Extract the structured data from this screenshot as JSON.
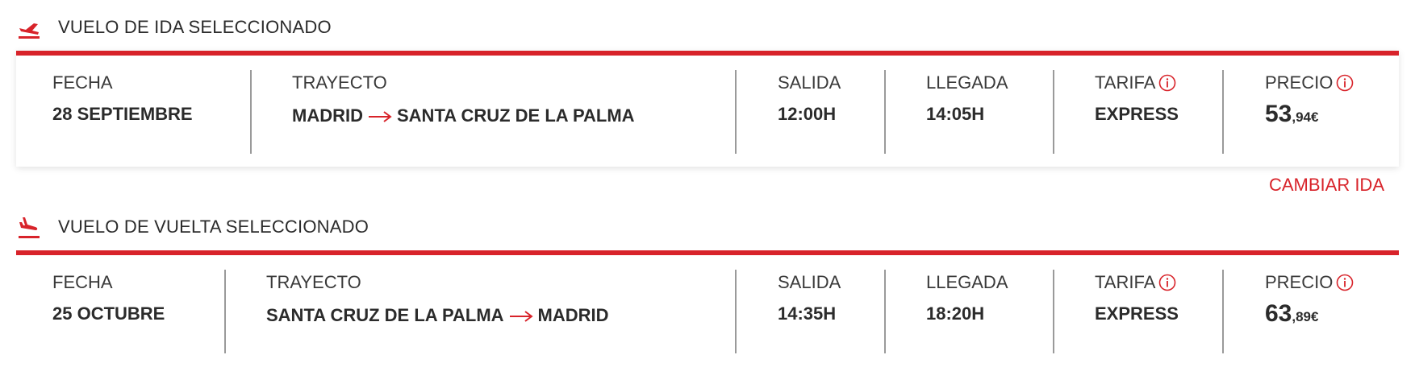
{
  "outbound": {
    "title": "VUELO DE IDA SELECCIONADO",
    "fecha_label": "FECHA",
    "fecha": "28 SEPTIEMBRE",
    "trayecto_label": "TRAYECTO",
    "origin": "MADRID",
    "destination": "SANTA CRUZ DE LA PALMA",
    "salida_label": "SALIDA",
    "salida": "12:00H",
    "llegada_label": "LLEGADA",
    "llegada": "14:05H",
    "tarifa_label": "TARIFA",
    "tarifa": "EXPRESS",
    "precio_label": "PRECIO",
    "precio_int": "53",
    "precio_dec": ",94€",
    "change_link": "CAMBIAR IDA"
  },
  "return": {
    "title": "VUELO DE VUELTA SELECCIONADO",
    "fecha_label": "FECHA",
    "fecha": "25 OCTUBRE",
    "trayecto_label": "TRAYECTO",
    "origin": "SANTA CRUZ DE LA PALMA",
    "destination": "MADRID",
    "salida_label": "SALIDA",
    "salida": "14:35H",
    "llegada_label": "LLEGADA",
    "llegada": "18:20H",
    "tarifa_label": "TARIFA",
    "tarifa": "EXPRESS",
    "precio_label": "PRECIO",
    "precio_int": "63",
    "precio_dec": ",89€"
  },
  "icons": {
    "arrow": "arrow-right-icon",
    "info": "info-icon",
    "departure": "plane-takeoff-icon",
    "arrival": "plane-landing-icon"
  },
  "colors": {
    "accent": "#d8232a",
    "text": "#2b2b2b",
    "divider": "#9a9a9a"
  }
}
